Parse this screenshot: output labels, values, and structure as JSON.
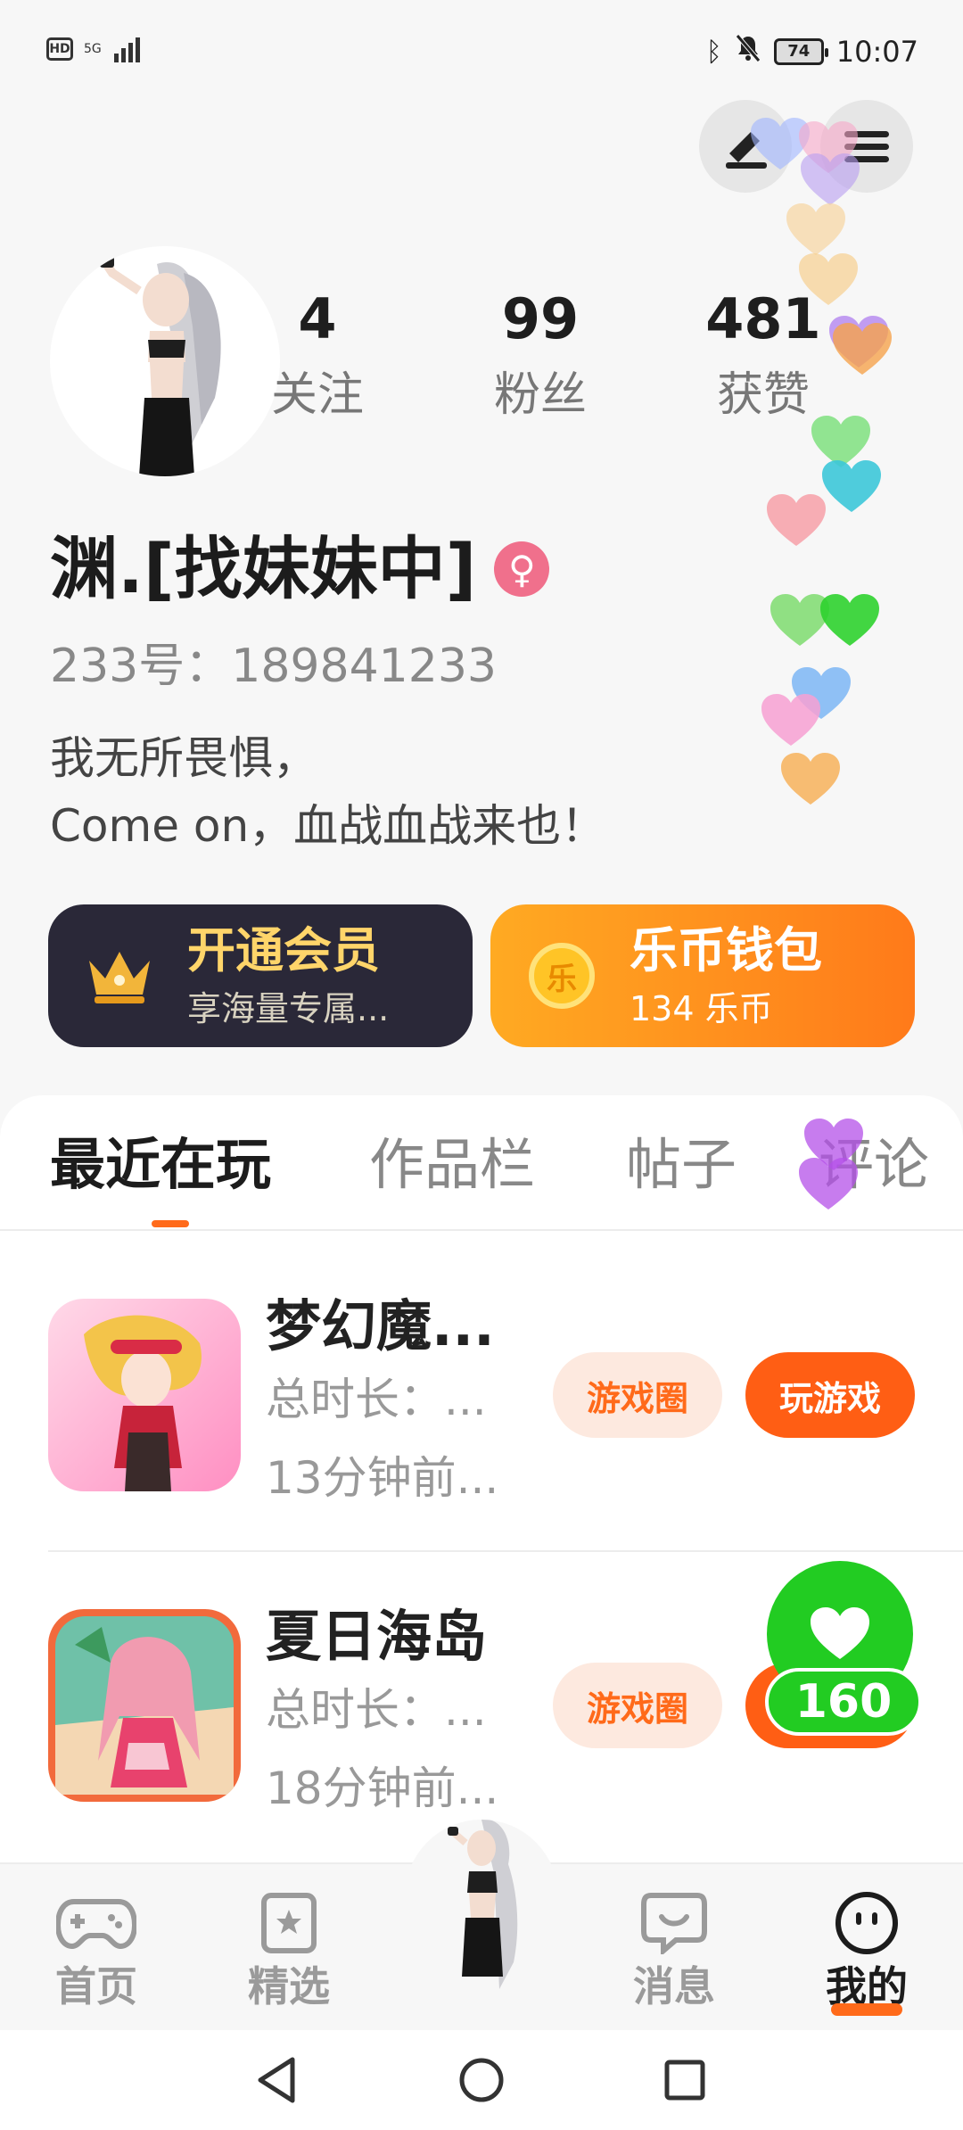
{
  "status_bar": {
    "network": "5G",
    "time": "10:07",
    "battery": "74"
  },
  "profile": {
    "stats": [
      {
        "value": "4",
        "label": "关注"
      },
      {
        "value": "99",
        "label": "粉丝"
      },
      {
        "value": "481",
        "label": "获赞"
      }
    ],
    "username": "渊.[找妹妹中]",
    "gender_symbol": "♀",
    "user_id": "233号：189841233",
    "bio_line1": "我无所畏惧，",
    "bio_line2": "Come on，血战血战来也！"
  },
  "cards": {
    "vip": {
      "title": "开通会员",
      "subtitle": "享海量专属..."
    },
    "wallet": {
      "title": "乐币钱包",
      "subtitle": "134 乐币",
      "coin_label": "乐"
    }
  },
  "tabs": [
    "最近在玩",
    "作品栏",
    "帖子",
    "评论"
  ],
  "games": [
    {
      "name": "梦幻魔...",
      "duration": "总时长：...",
      "last_played": "13分钟前...",
      "circle_label": "游戏圈",
      "play_label": "玩游戏"
    },
    {
      "name": "夏日海岛",
      "duration": "总时长：...",
      "last_played": "18分钟前...",
      "circle_label": "游戏圈"
    }
  ],
  "like_widget": {
    "count": "160"
  },
  "bottom_nav": [
    {
      "label": "首页",
      "icon": "gamepad-icon"
    },
    {
      "label": "精选",
      "icon": "star-icon"
    },
    {
      "label": "消息",
      "icon": "chat-icon"
    },
    {
      "label": "我的",
      "icon": "smiley-icon"
    }
  ],
  "colors": {
    "accent": "#ff6a1a",
    "vip_card": "#2a2838",
    "like_green": "#22cc22"
  }
}
